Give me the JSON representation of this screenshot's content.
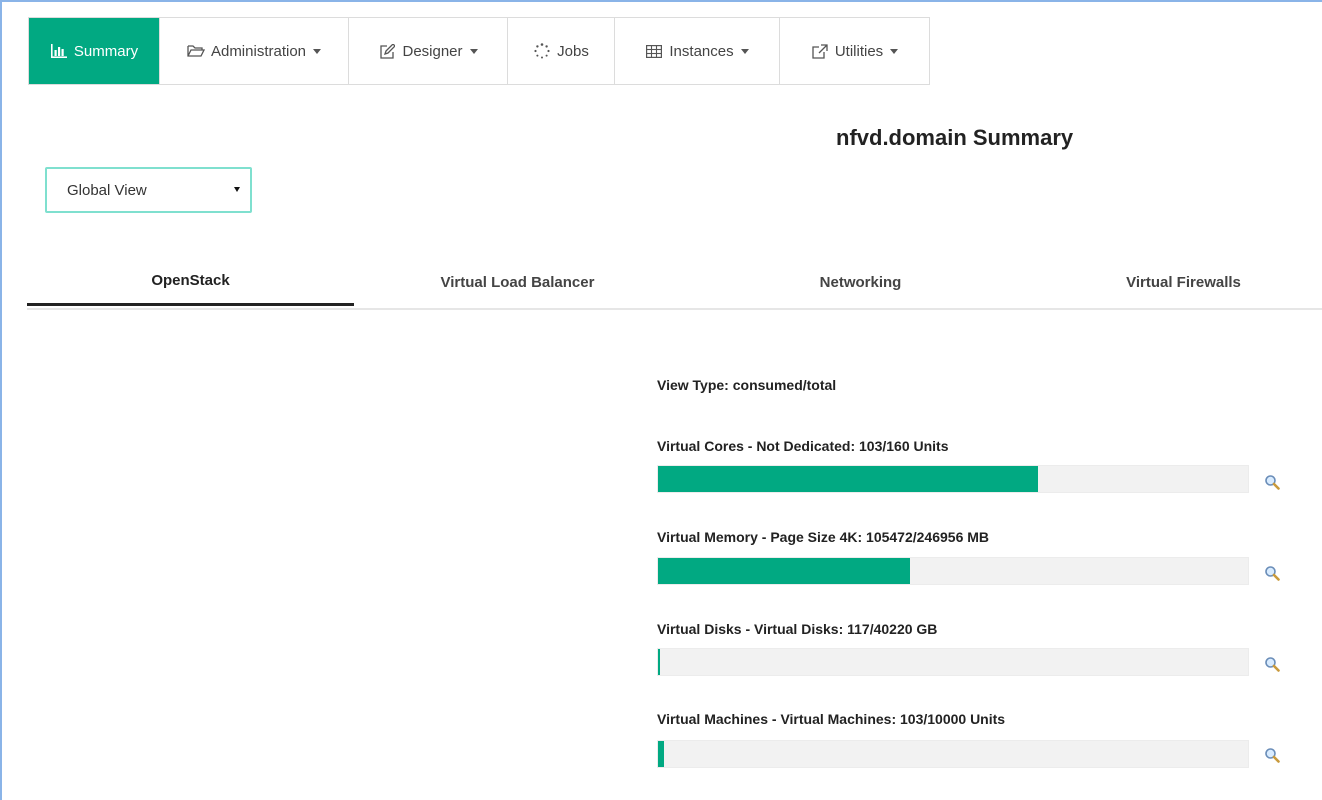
{
  "nav": {
    "items": [
      {
        "label": "Summary",
        "icon": "bar-chart-icon",
        "active": true,
        "dropdown": false
      },
      {
        "label": "Administration",
        "icon": "folder-open-icon",
        "active": false,
        "dropdown": true
      },
      {
        "label": "Designer",
        "icon": "edit-icon",
        "active": false,
        "dropdown": true
      },
      {
        "label": "Jobs",
        "icon": "spinner-icon",
        "active": false,
        "dropdown": false
      },
      {
        "label": "Instances",
        "icon": "table-icon",
        "active": false,
        "dropdown": true
      },
      {
        "label": "Utilities",
        "icon": "external-link-icon",
        "active": false,
        "dropdown": true
      }
    ]
  },
  "page": {
    "title": "nfvd.domain Summary"
  },
  "view_select": {
    "value": "Global View"
  },
  "tabs": [
    {
      "label": "OpenStack",
      "active": true
    },
    {
      "label": "Virtual Load Balancer",
      "active": false
    },
    {
      "label": "Networking",
      "active": false
    },
    {
      "label": "Virtual Firewalls",
      "active": false
    }
  ],
  "summary": {
    "view_type": "View Type: consumed/total",
    "metrics": [
      {
        "label": "Virtual Cores - Not Dedicated:  103/160 Units",
        "consumed": 103,
        "total": 160
      },
      {
        "label": "Virtual Memory - Page Size 4K:  105472/246956 MB",
        "consumed": 105472,
        "total": 246956
      },
      {
        "label": "Virtual Disks - Virtual Disks:  117/40220 GB",
        "consumed": 117,
        "total": 40220
      },
      {
        "label": "Virtual Machines - Virtual Machines:  103/10000 Units",
        "consumed": 103,
        "total": 10000
      }
    ]
  },
  "colors": {
    "accent": "#01a982",
    "bar_bg": "#f2f2f2",
    "select_border": "#7fe0cf"
  }
}
